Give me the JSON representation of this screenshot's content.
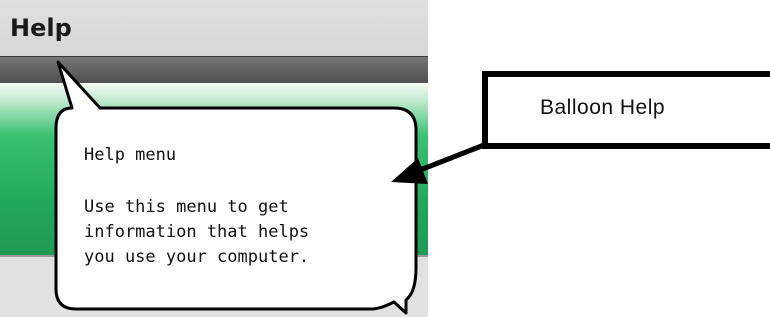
{
  "menubar": {
    "title": "Help"
  },
  "balloon": {
    "heading": "Help menu",
    "body_lines": [
      "Use this menu to get",
      "information that helps",
      "you use your computer."
    ]
  },
  "callout": {
    "label": "Balloon Help"
  },
  "colors": {
    "menubar": "#d9d9d9",
    "strip": "#5a5a5a",
    "green": "#22a85c",
    "balloon_fill": "#ffffff",
    "outline": "#000000"
  }
}
